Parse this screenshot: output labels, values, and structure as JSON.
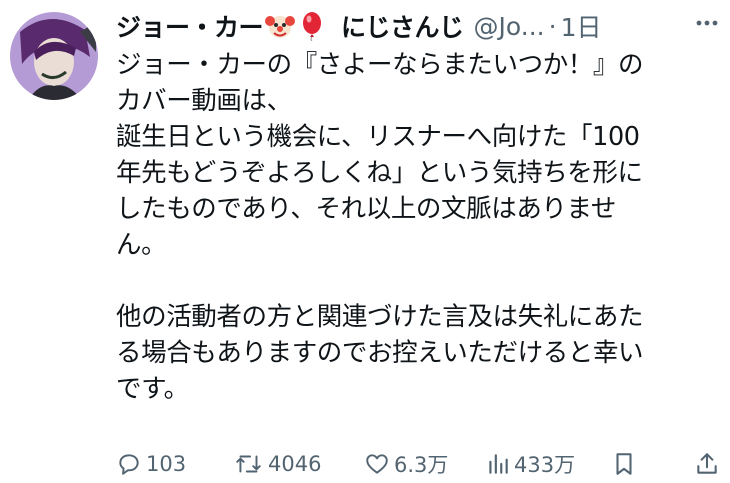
{
  "author": {
    "display_name": "ジョー・カー",
    "emojis": [
      "clown-face-icon",
      "balloon-icon"
    ],
    "affiliation": "にじさんじ",
    "handle": "@Jo...",
    "separator": "·",
    "timestamp": "1日"
  },
  "tweet_text": "ジョー・カーの『さよーならまたいつか！』の\nカバー動画は、\n誕生日という機会に、リスナーへ向けた「100\n年先もどうぞよろしくね」という気持ちを形に\nしたものであり、それ以上の文脈はありませ\nん。\n\n他の活動者の方と関連づけた言及は失礼にあた\nる場合もありますのでお控えいただけると幸い\nです。",
  "actions": {
    "replies": "103",
    "reposts": "4046",
    "likes": "6.3万",
    "views": "433万"
  },
  "colors": {
    "text": "#0f1419",
    "muted": "#536471",
    "background": "#ffffff"
  }
}
